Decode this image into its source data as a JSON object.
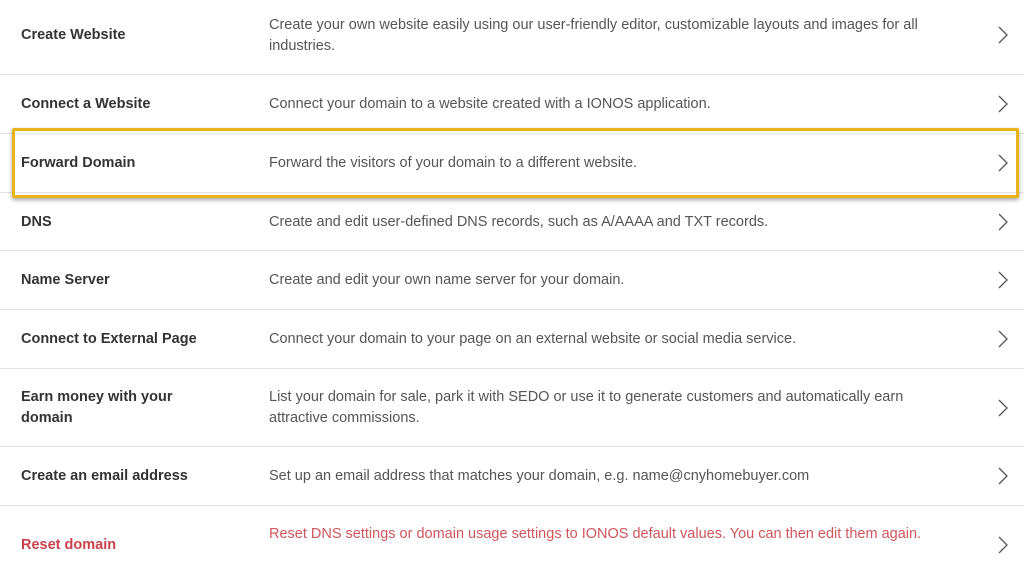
{
  "rows": [
    {
      "title": "Create Website",
      "description": "Create your own website easily using our user-friendly editor, customizable layouts and images for all industries."
    },
    {
      "title": "Connect a Website",
      "description": "Connect your domain to a website created with a IONOS application."
    },
    {
      "title": "Forward Domain",
      "description": "Forward the visitors of your domain to a different website."
    },
    {
      "title": "DNS",
      "description": "Create and edit user-defined DNS records, such as A/AAAA and TXT records."
    },
    {
      "title": "Name Server",
      "description": "Create and edit your own name server for your domain."
    },
    {
      "title": "Connect to External Page",
      "description": "Connect your domain to your page on an external website or social media service."
    },
    {
      "title": "Earn money with your domain",
      "description": "List your domain for sale, park it with SEDO or use it to generate customers and automatically earn attractive commissions."
    },
    {
      "title": "Create an email address",
      "description": "Set up an email address that matches your domain, e.g. name@cnyhomebuyer.com"
    },
    {
      "title": "Reset domain",
      "description": "Reset DNS settings or domain usage settings to IONOS default values. You can then edit them again."
    }
  ],
  "icons": {
    "row_chevron": "chevron-right-icon"
  },
  "colors": {
    "highlight_border": "#e8b31c",
    "danger_text": "#c9424b",
    "divider": "#e3e3e3"
  }
}
